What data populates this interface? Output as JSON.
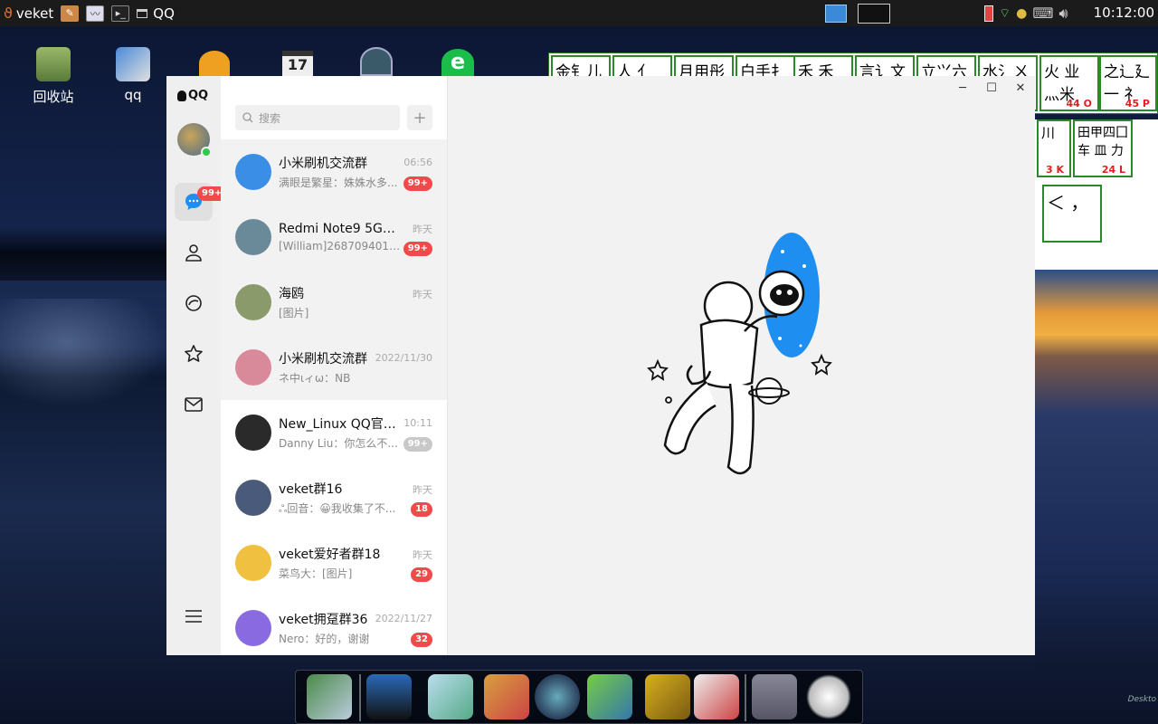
{
  "topbar": {
    "app_menu": "veket",
    "active_window": "QQ",
    "clock": "10:12:00"
  },
  "desktop": {
    "icons": [
      {
        "label": "回收站",
        "icon": "recycle-bin-icon"
      },
      {
        "label": "qq",
        "icon": "qq-installer-icon"
      }
    ],
    "ime_keys": [
      {
        "text": "金钅儿乂",
        "num": ""
      },
      {
        "text": "人 亻",
        "num": ""
      },
      {
        "text": "月用彤用",
        "num": ""
      },
      {
        "text": "白手扌",
        "num": ""
      },
      {
        "text": "禾 禾 ㄅ",
        "num": ""
      },
      {
        "text": "言讠文方",
        "num": ""
      },
      {
        "text": "立⺍六冫",
        "num": ""
      },
      {
        "text": "水氵ㄨ",
        "num": ""
      },
      {
        "text": "火 业 灬米",
        "num": "44 O"
      },
      {
        "text": "之辶廴 一 礻",
        "num": "45 P"
      },
      {
        "text": "川",
        "num": "3 K"
      },
      {
        "text": "田甲四囗 车 皿 力",
        "num": "24 L"
      },
      {
        "text": "＜ ，",
        "num": ""
      }
    ],
    "corner_label": "Deskto"
  },
  "qq": {
    "logo_text": "QQ",
    "message_badge": "99+",
    "search_placeholder": "搜索",
    "add_label": "+",
    "conversations": [
      {
        "name": "小米刷机交流群",
        "time": "06:56",
        "msg": "满眼是繁星：姝姝水多...",
        "badge": "99+",
        "muted": false,
        "pinned": true,
        "color": "#3a8ee6"
      },
      {
        "name": "Redmi Note9 5G稳定...",
        "time": "昨天",
        "msg": "[William]2687094017...",
        "badge": "99+",
        "muted": false,
        "pinned": true,
        "color": "#6a8a9a"
      },
      {
        "name": "海鸥",
        "time": "昨天",
        "msg": "[图片]",
        "badge": "",
        "muted": false,
        "pinned": true,
        "color": "#8a9a6a"
      },
      {
        "name": "小米刷机交流群",
        "time": "2022/11/30",
        "msg": "ネ中ιィω：NB",
        "badge": "",
        "muted": false,
        "pinned": true,
        "color": "#d98a9a"
      },
      {
        "name": "New_Linux QQ官方...",
        "time": "10:11",
        "msg": "Danny Liu：你怎么不...",
        "badge": "99+",
        "muted": true,
        "pinned": false,
        "color": "#2a2a2a"
      },
      {
        "name": "veket群16",
        "time": "昨天",
        "msg": "ஃ回音：😀我收集了不...",
        "badge": "18",
        "muted": false,
        "pinned": false,
        "color": "#4a5a7a"
      },
      {
        "name": "veket爱好者群18",
        "time": "昨天",
        "msg": "菜鸟大：[图片]",
        "badge": "29",
        "muted": false,
        "pinned": false,
        "color": "#f0c040"
      },
      {
        "name": "veket拥趸群36",
        "time": "2022/11/27",
        "msg": "Nero：好的，谢谢",
        "badge": "32",
        "muted": false,
        "pinned": false,
        "color": "#8a6ae0"
      }
    ]
  }
}
